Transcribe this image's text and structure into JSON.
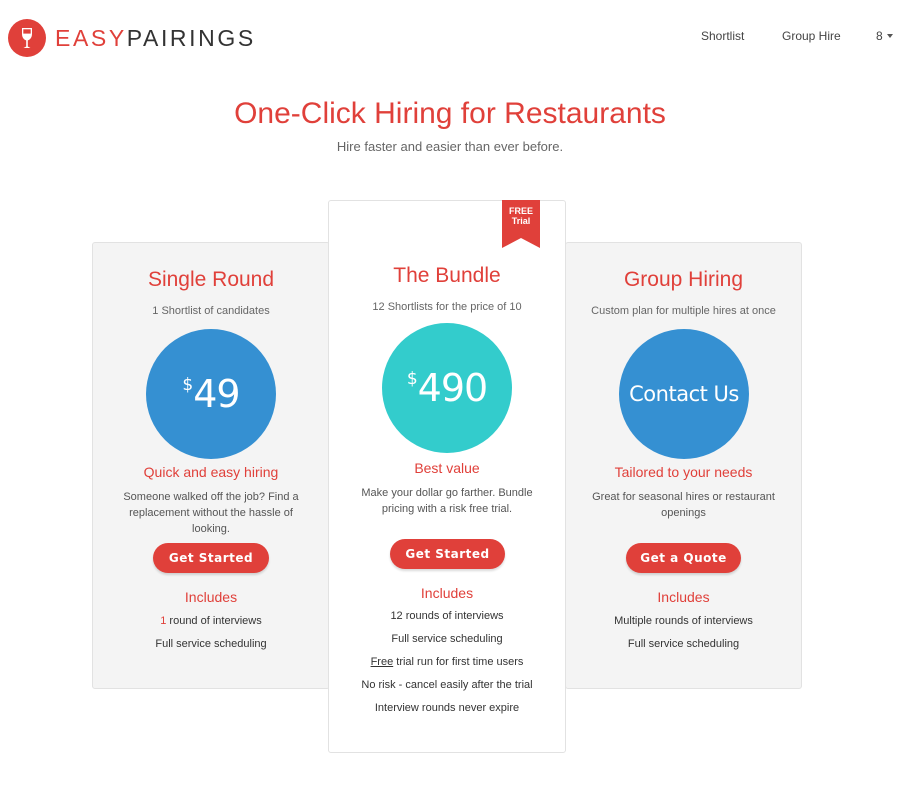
{
  "brand": {
    "part1": "EASY",
    "part2": "PAIRINGS",
    "color": "#e0403a"
  },
  "nav": {
    "shortlist": "Shortlist",
    "group_hire": "Group Hire",
    "user": "8"
  },
  "hero": {
    "title": "One-Click Hiring for Restaurants",
    "subtitle": "Hire faster and easier than ever before."
  },
  "plans": {
    "single": {
      "title": "Single Round",
      "subtitle": "1 Shortlist of candidates",
      "currency": "$",
      "price": "49",
      "tagline": "Quick and easy hiring",
      "description": "Someone walked off the job? Find a replacement without the hassle of looking.",
      "button": "Get Started",
      "includes_title": "Includes",
      "includes": {
        "i1_num": "1",
        "i1_rest": " round of interviews",
        "i2": "Full service scheduling"
      }
    },
    "bundle": {
      "ribbon_line1": "FREE",
      "ribbon_line2": "Trial",
      "title": "The Bundle",
      "subtitle": "12 Shortlists for the price of 10",
      "currency": "$",
      "price": "490",
      "tagline": "Best value",
      "description": "Make your dollar go farther. Bundle pricing with a risk free trial.",
      "button": "Get Started",
      "includes_title": "Includes",
      "includes": {
        "i1": "12 rounds of interviews",
        "i2": "Full service scheduling",
        "i3_free": "Free",
        "i3_rest": " trial run for first time users",
        "i4": "No risk - cancel easily after the trial",
        "i5": "Interview rounds never expire"
      }
    },
    "group": {
      "title": "Group Hiring",
      "subtitle": "Custom plan for multiple hires at once",
      "circle_text": "Contact Us",
      "tagline": "Tailored to your needs",
      "description": "Great for seasonal hires or restaurant openings",
      "button": "Get a Quote",
      "includes_title": "Includes",
      "includes": {
        "i1": "Multiple rounds of interviews",
        "i2": "Full service scheduling"
      }
    }
  },
  "colors": {
    "accent": "#e0403a",
    "blue": "#3590d2",
    "teal": "#33cccc",
    "card_bg": "#f4f4f4"
  },
  "icons": {
    "logo": "wine-glass-icon",
    "user_menu": "caret-down-icon"
  }
}
